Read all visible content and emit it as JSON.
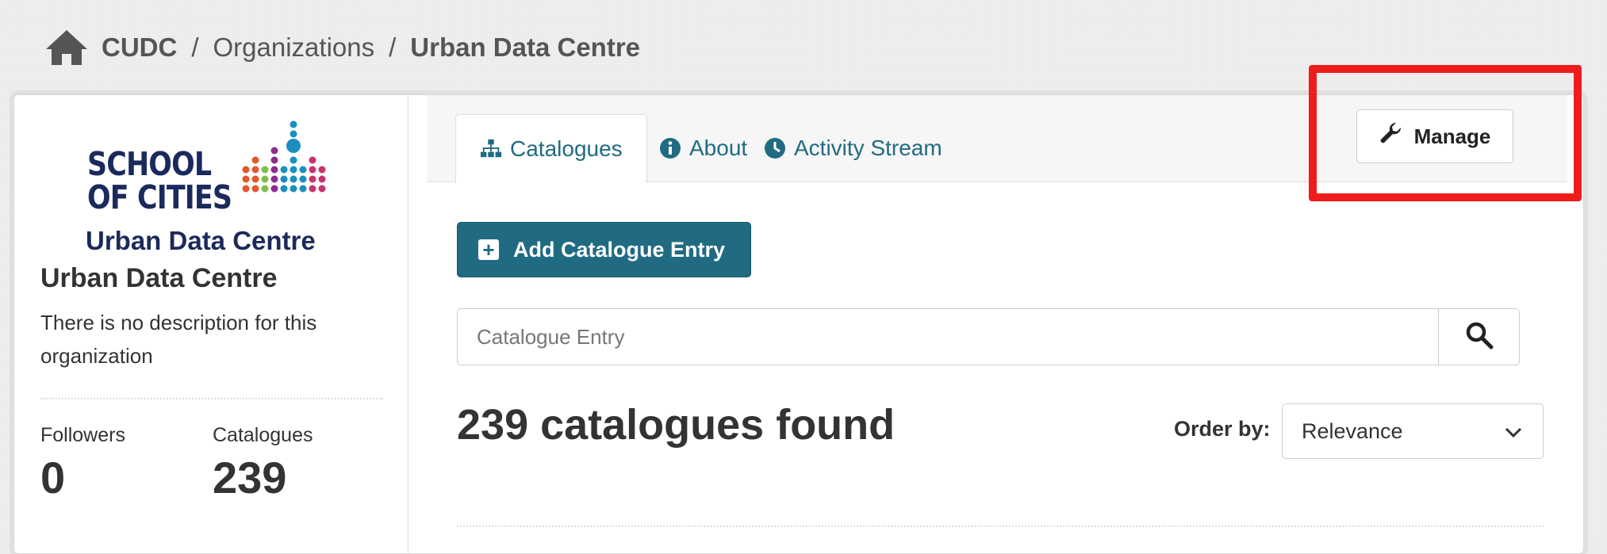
{
  "breadcrumb": {
    "home_icon": "home-icon",
    "root": "CUDC",
    "sep1": "/",
    "organizations": "Organizations",
    "sep2": "/",
    "current": "Urban Data Centre"
  },
  "sidebar": {
    "logo": {
      "line1": "SCHOOL",
      "line2": "OF CITIES",
      "subtitle": "Urban Data Centre"
    },
    "org_title": "Urban Data Centre",
    "description": "There is no description for this organization",
    "stats": [
      {
        "label": "Followers",
        "value": "0"
      },
      {
        "label": "Catalogues",
        "value": "239"
      }
    ]
  },
  "tabs": [
    {
      "label": "Catalogues",
      "icon": "sitemap-icon",
      "active": true
    },
    {
      "label": "About",
      "icon": "info-icon",
      "active": false
    },
    {
      "label": "Activity Stream",
      "icon": "clock-icon",
      "active": false
    }
  ],
  "manage_button": {
    "label": "Manage",
    "icon": "wrench-icon"
  },
  "add_button": {
    "label": "Add Catalogue Entry",
    "icon": "plus-square-icon"
  },
  "search": {
    "placeholder": "Catalogue Entry",
    "value": ""
  },
  "results": {
    "title": "239 catalogues found"
  },
  "order": {
    "label": "Order by:",
    "selected": "Relevance"
  },
  "colors": {
    "accent": "#206b82",
    "highlight": "#ee1c1c",
    "logo_navy": "#1b2a5c"
  }
}
